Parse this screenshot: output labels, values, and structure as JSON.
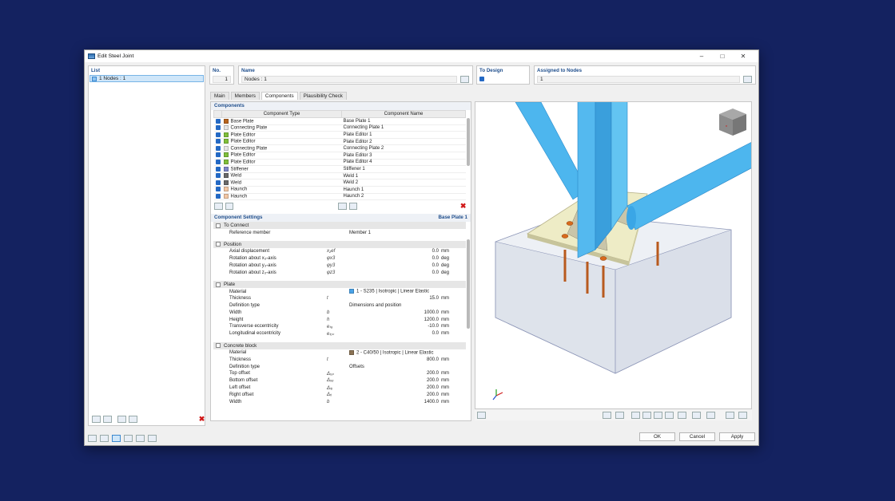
{
  "window": {
    "title": "Edit Steel Joint"
  },
  "list": {
    "header": "List",
    "item": "1 Nodes : 1"
  },
  "fields": {
    "no_label": "No.",
    "no_value": "1",
    "name_label": "Name",
    "name_value": "Nodes : 1",
    "todesign_label": "To Design",
    "assigned_label": "Assigned to Nodes",
    "assigned_value": "1"
  },
  "tabs": [
    "Main",
    "Members",
    "Components",
    "Plausibility Check"
  ],
  "components": {
    "header": "Components",
    "col_type": "Component Type",
    "col_name": "Component Name",
    "rows": [
      {
        "type": "Base Plate",
        "name": "Base Plate 1",
        "color": "#b8651f"
      },
      {
        "type": "Connecting Plate",
        "name": "Connecting Plate 1",
        "color": "#e6e6e6"
      },
      {
        "type": "Plate Editor",
        "name": "Plate Editor 1",
        "color": "#7fbf3a"
      },
      {
        "type": "Plate Editor",
        "name": "Plate Editor 2",
        "color": "#7fbf3a"
      },
      {
        "type": "Connecting Plate",
        "name": "Connecting Plate 2",
        "color": "#e6e6e6"
      },
      {
        "type": "Plate Editor",
        "name": "Plate Editor 3",
        "color": "#7fbf3a"
      },
      {
        "type": "Plate Editor",
        "name": "Plate Editor 4",
        "color": "#7fbf3a"
      },
      {
        "type": "Stiffener",
        "name": "Stiffener 1",
        "color": "#7e86c8"
      },
      {
        "type": "Weld",
        "name": "Weld 1",
        "color": "#6a6a6a"
      },
      {
        "type": "Weld",
        "name": "Weld 2",
        "color": "#6a6a6a"
      },
      {
        "type": "Haunch",
        "name": "Haunch 1",
        "color": "#f3c7a4"
      },
      {
        "type": "Haunch",
        "name": "Haunch 2",
        "color": "#f3c7a4"
      }
    ]
  },
  "settings": {
    "header": "Component Settings",
    "current": "Base Plate 1",
    "to_connect": {
      "title": "To Connect",
      "ref_label": "Reference member",
      "ref_value": "Member 1"
    },
    "position": {
      "title": "Position",
      "rows": [
        {
          "name": "Axial displacement",
          "sym": "x₂ef",
          "val": "0.0",
          "unit": "mm"
        },
        {
          "name": "Rotation about x₃-axis",
          "sym": "φx3",
          "val": "0.0",
          "unit": "deg"
        },
        {
          "name": "Rotation about y₃-axis",
          "sym": "φy3",
          "val": "0.0",
          "unit": "deg"
        },
        {
          "name": "Rotation about z₃-axis",
          "sym": "φz3",
          "val": "0.0",
          "unit": "deg"
        }
      ]
    },
    "plate": {
      "title": "Plate",
      "material": "1 - S235 | Isotropic | Linear Elastic",
      "material_color": "#4aa3e8",
      "rows": [
        {
          "name": "Thickness",
          "sym": "t",
          "val": "15.0",
          "unit": "mm"
        },
        {
          "name": "Width",
          "sym": "b",
          "val": "1000.0",
          "unit": "mm"
        },
        {
          "name": "Height",
          "sym": "h",
          "val": "1200.0",
          "unit": "mm"
        },
        {
          "name": "Transverse eccentricity",
          "sym": "eₜₐ",
          "val": "-10.0",
          "unit": "mm"
        },
        {
          "name": "Longitudinal eccentricity",
          "sym": "eₗₒₙ",
          "val": "0.0",
          "unit": "mm"
        }
      ],
      "deftype_label": "Definition type",
      "deftype_value": "Dimensions and position",
      "material_label": "Material"
    },
    "concrete": {
      "title": "Concrete block",
      "material_label": "Material",
      "material": "2 - C40/50 | Isotropic | Linear Elastic",
      "material_color": "#8b7355",
      "thickness": {
        "name": "Thickness",
        "sym": "t",
        "val": "800.0",
        "unit": "mm"
      },
      "deftype_label": "Definition type",
      "deftype_value": "Offsets",
      "rows": [
        {
          "name": "Top offset",
          "sym": "Δₓₚ",
          "val": "200.0",
          "unit": "mm"
        },
        {
          "name": "Bottom offset",
          "sym": "Δₓₑ",
          "val": "200.0",
          "unit": "mm"
        },
        {
          "name": "Left offset",
          "sym": "Δₗₑ",
          "val": "200.0",
          "unit": "mm"
        },
        {
          "name": "Right offset",
          "sym": "Δᵣᵢ",
          "val": "200.0",
          "unit": "mm"
        },
        {
          "name": "Width",
          "sym": "b",
          "val": "1400.0",
          "unit": "mm"
        }
      ]
    }
  },
  "buttons": {
    "ok": "OK",
    "cancel": "Cancel",
    "apply": "Apply"
  }
}
